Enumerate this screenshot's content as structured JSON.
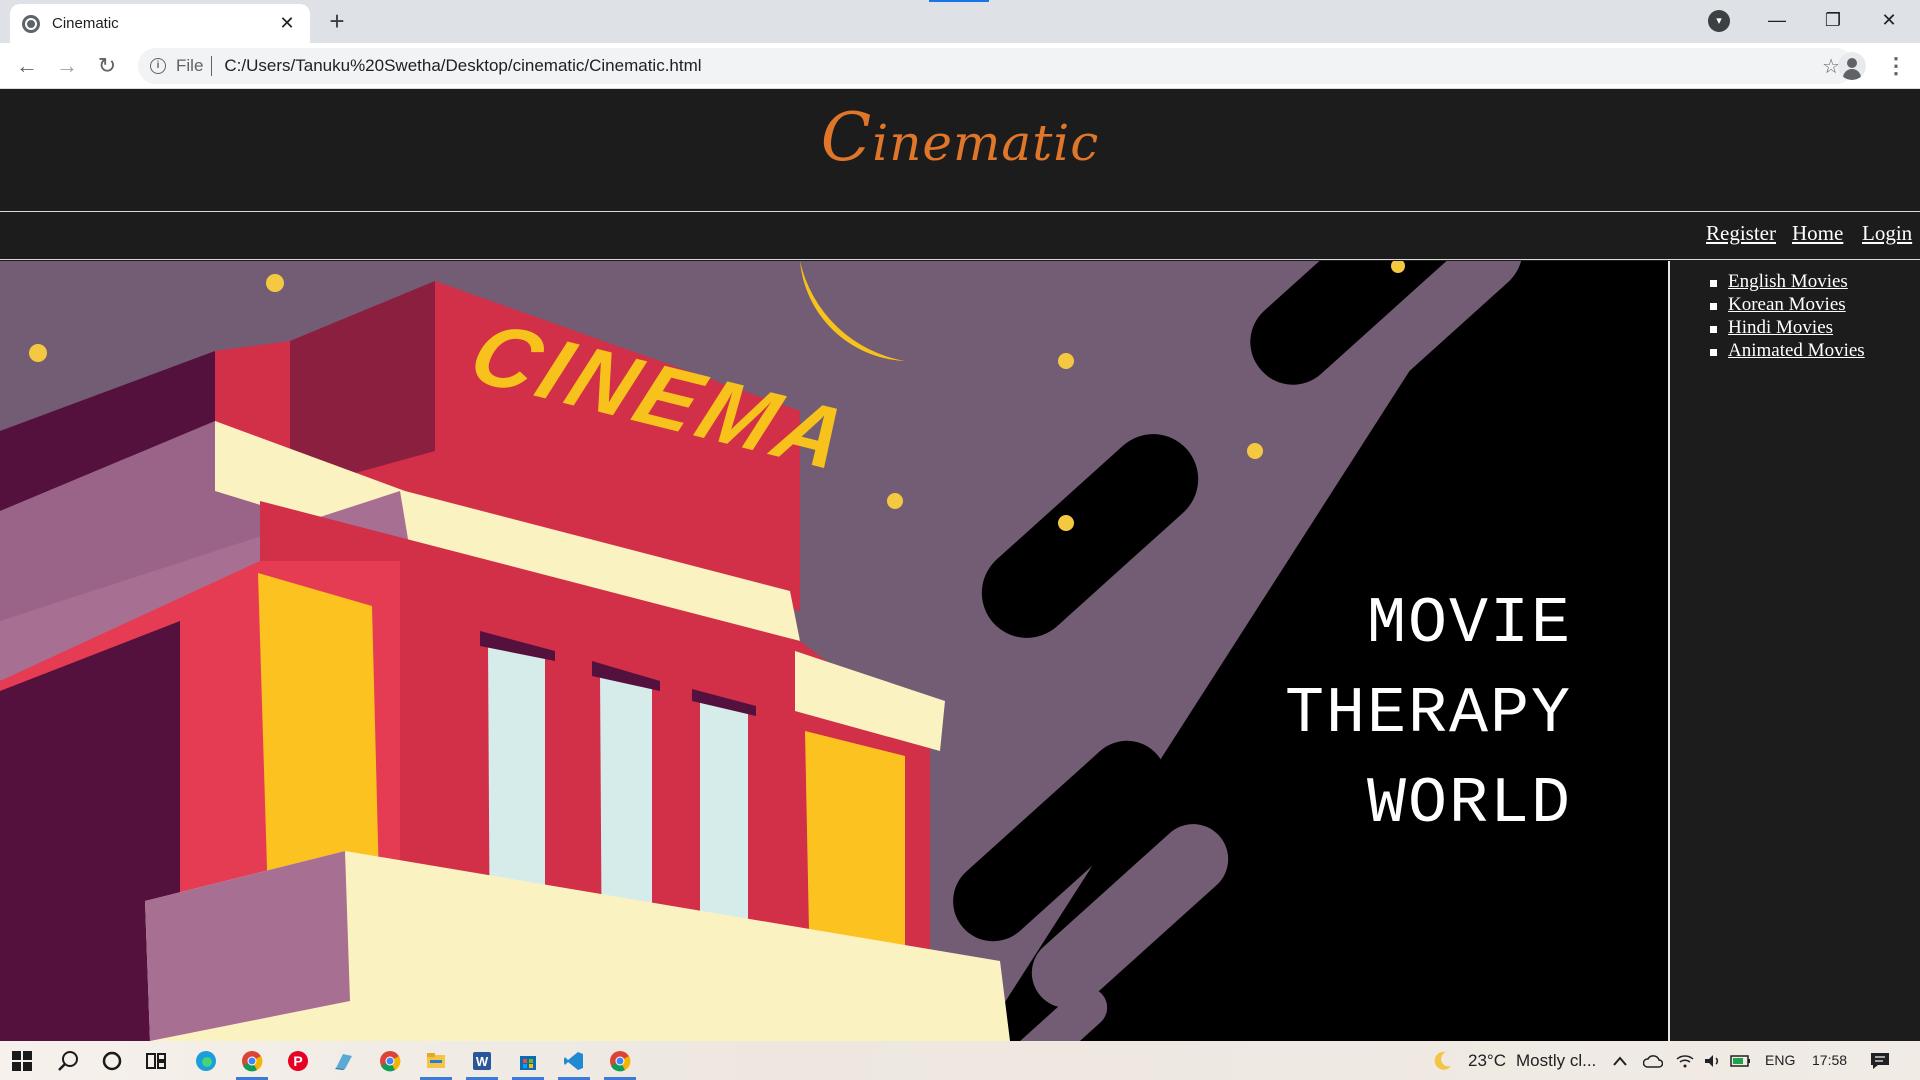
{
  "browser": {
    "tab_title": "Cinematic",
    "tab_close": "✕",
    "new_tab": "+",
    "scheme_label": "File",
    "url": "C:/Users/Tanuku%20Swetha/Desktop/cinematic/Cinematic.html",
    "back": "←",
    "forward": "→",
    "reload": "↻",
    "bookmark": "☆",
    "menu": "⋮",
    "minimize": "—",
    "restore": "❐",
    "close": "✕",
    "tab_search": "▾"
  },
  "site": {
    "logo_first": "C",
    "logo_rest": "inematic",
    "nav": [
      "Register",
      "Home",
      "Login"
    ],
    "hero_lines": [
      "MOVIE",
      "THERAPY",
      "WORLD"
    ],
    "hero_sign": "CINEMA",
    "sidebar_links": [
      "English Movies",
      "Korean Movies",
      "Hindi Movies",
      "Animated Movies"
    ],
    "accent_color": "#e0762a"
  },
  "taskbar": {
    "weather_temp": "23°C",
    "weather_text": "Mostly cl...",
    "language": "ENG",
    "time": "17:58"
  }
}
